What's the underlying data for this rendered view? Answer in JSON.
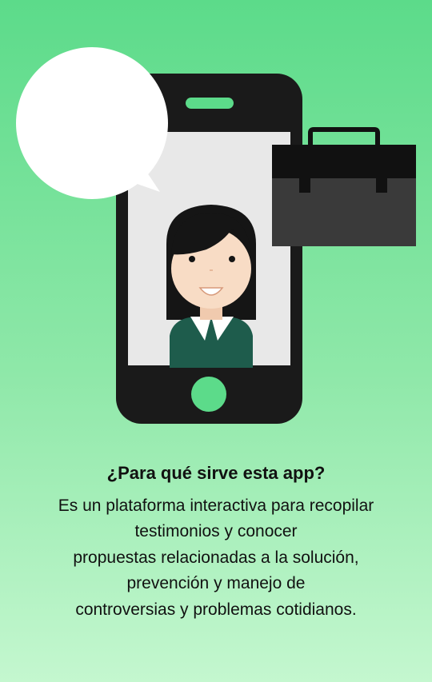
{
  "illustration": {
    "icons": [
      "speech-bubble-icon",
      "smartphone-icon",
      "briefcase-icon",
      "woman-avatar-icon"
    ],
    "colors": {
      "phone": "#1a1a1a",
      "screen": "#e8e8e8",
      "accent": "#5cdb8a",
      "shirt": "#1e5c4c",
      "skin": "#f8dcc5",
      "hair": "#151515"
    }
  },
  "content": {
    "title": "¿Para qué sirve esta app?",
    "description_lines": [
      "Es un plataforma interactiva para recopilar",
      "testimonios y conocer",
      "propuestas relacionadas a la solución,",
      "prevención y manejo de",
      "controversias y problemas cotidianos."
    ]
  }
}
